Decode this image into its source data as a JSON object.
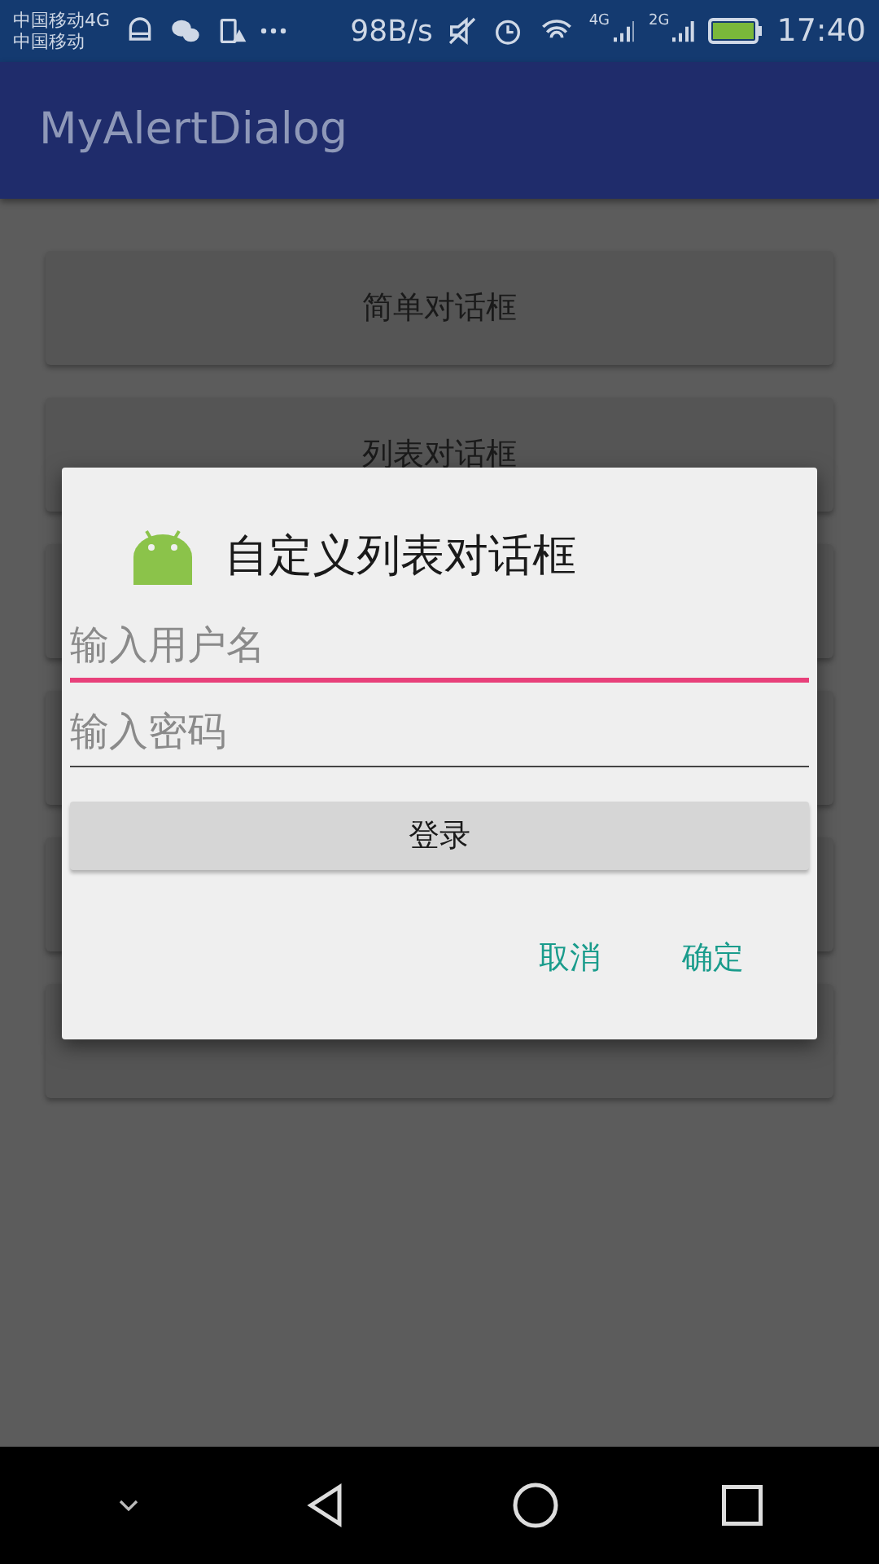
{
  "status_bar": {
    "carrier_1": "中国移动4G",
    "carrier_2": "中国移动",
    "speed": "98B/s",
    "signal_1": "4G",
    "signal_2": "2G",
    "time": "17:40"
  },
  "app_bar": {
    "title": "MyAlertDialog"
  },
  "buttons": [
    {
      "kind": "button",
      "label": "简单对话框"
    },
    {
      "kind": "button",
      "label": "列表对话框"
    },
    {
      "kind": "button"
    },
    {
      "kind": "button"
    },
    {
      "kind": "button"
    },
    {
      "kind": "button"
    }
  ],
  "dialog": {
    "title": "自定义列表对话框",
    "fields": [
      {
        "placeholder": "输入用户名",
        "focused": true
      },
      {
        "placeholder": "输入密码",
        "focused": false
      }
    ],
    "login_button": "登录",
    "actions": [
      "取消",
      "确定"
    ]
  }
}
